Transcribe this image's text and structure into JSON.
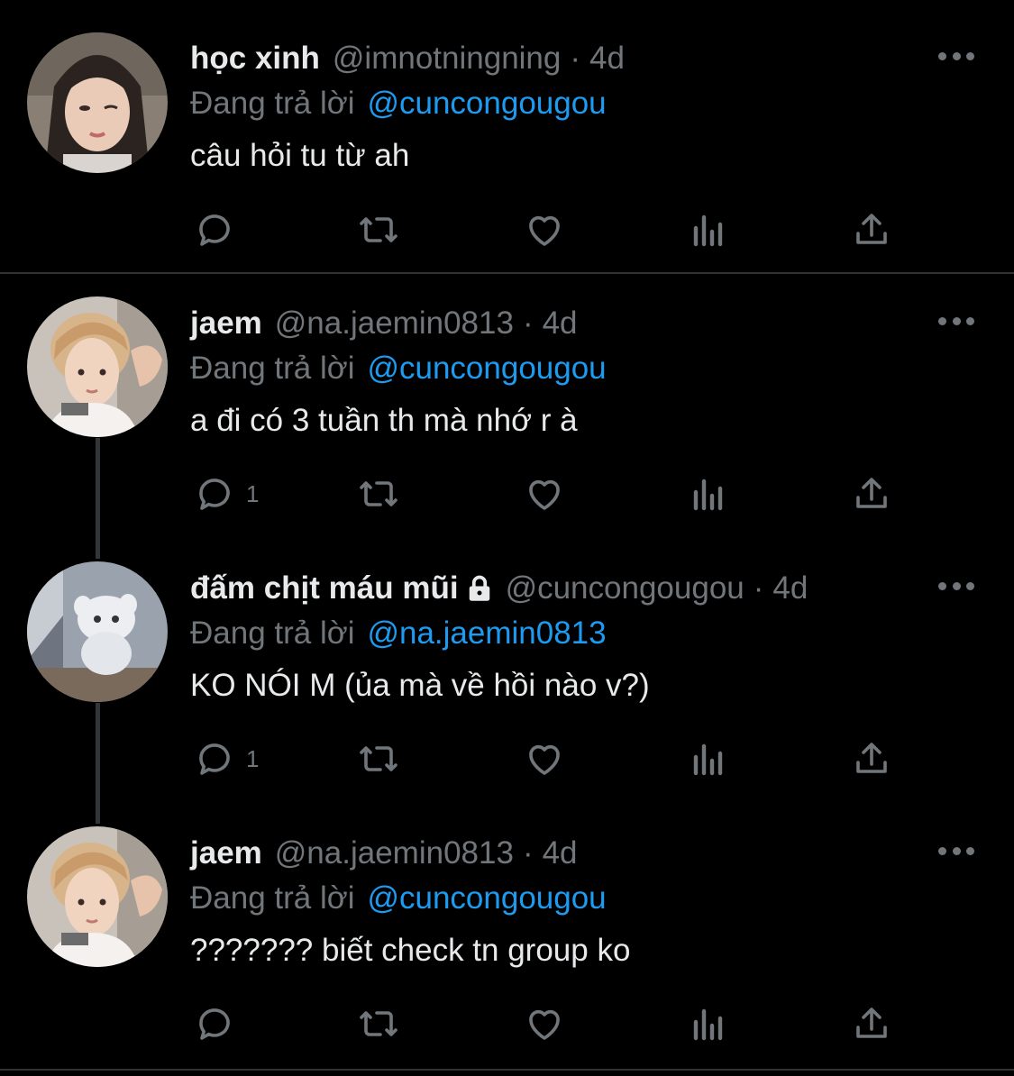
{
  "colors": {
    "background": "#000000",
    "text": "#e7e9ea",
    "muted": "#71767b",
    "link": "#1d9bf0",
    "divider": "#2f3336"
  },
  "tweets": [
    {
      "name": "học xinh",
      "handle": "@imnotningning",
      "dot": "·",
      "time": "4d",
      "reply_prefix": "Đang trả lời",
      "reply_to": "@cuncongougou",
      "text": "câu hỏi tu từ ah",
      "reply_count": "",
      "avatar": "girl-portrait"
    },
    {
      "name": "jaem",
      "handle": "@na.jaemin0813",
      "dot": "·",
      "time": "4d",
      "reply_prefix": "Đang trả lời",
      "reply_to": "@cuncongougou",
      "text": "a đi có 3 tuần th mà nhớ r à",
      "reply_count": "1",
      "avatar": "boy-portrait"
    },
    {
      "name": "đấm chịt máu mũi",
      "locked": true,
      "handle": "@cuncongougou",
      "dot": "·",
      "time": "4d",
      "reply_prefix": "Đang trả lời",
      "reply_to": "@na.jaemin0813",
      "text": "KO NÓI M (ủa mà về hồi nào v?)",
      "reply_count": "1",
      "avatar": "plush-toy"
    },
    {
      "name": "jaem",
      "handle": "@na.jaemin0813",
      "dot": "·",
      "time": "4d",
      "reply_prefix": "Đang trả lời",
      "reply_to": "@cuncongougou",
      "text": "??????? biết check tn group ko",
      "reply_count": "",
      "avatar": "boy-portrait"
    }
  ],
  "actions": [
    "reply-icon",
    "retweet-icon",
    "like-icon",
    "views-icon",
    "share-icon"
  ]
}
